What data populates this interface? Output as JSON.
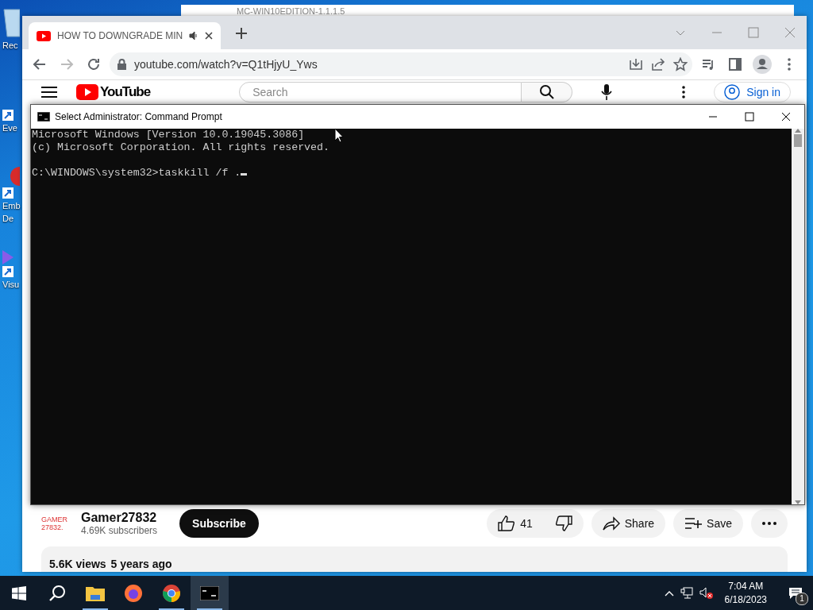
{
  "desktop_icons": [
    {
      "kind": "recycle",
      "lines": [
        "Rec"
      ]
    },
    {
      "kind": "shortcut",
      "lines": [
        "Eve"
      ]
    },
    {
      "kind": "red",
      "lines": [
        "Emb",
        "De"
      ]
    },
    {
      "kind": "purple",
      "lines": [
        "Visu"
      ]
    }
  ],
  "background_window": {
    "title": "MC-WIN10EDITION-1.1.1.5"
  },
  "browser": {
    "tabs": [
      {
        "title": "HOW TO DOWNGRADE MIN",
        "selected": true
      }
    ],
    "address": "youtube.com/watch?v=Q1tHjyU_Yws"
  },
  "youtube": {
    "logo": "YouTube",
    "search_placeholder": "Search",
    "sign_in": "Sign in",
    "avatar_lines": [
      "GAMER",
      "27832."
    ],
    "channel_name": "Gamer27832",
    "subscribers": "4.69K subscribers",
    "subscribe": "Subscribe",
    "likes": "41",
    "share": "Share",
    "save": "Save",
    "views": "5.6K views",
    "age": "5 years ago"
  },
  "console": {
    "title": "Select Administrator:  Command Prompt",
    "lines": [
      "Microsoft Windows [Version 10.0.19045.3086]",
      "(c) Microsoft Corporation. All rights reserved."
    ],
    "prompt": "C:\\WINDOWS\\system32>taskkill /f ."
  },
  "taskbar": {
    "apps": [
      {
        "kind": "explorer",
        "running": true,
        "selected": false
      },
      {
        "kind": "firefox",
        "running": false,
        "selected": false
      },
      {
        "kind": "chrome",
        "running": true,
        "selected": false
      },
      {
        "kind": "cmd",
        "running": true,
        "selected": true
      }
    ],
    "time": "7:04 AM",
    "date": "6/18/2023",
    "notifications": "1"
  }
}
